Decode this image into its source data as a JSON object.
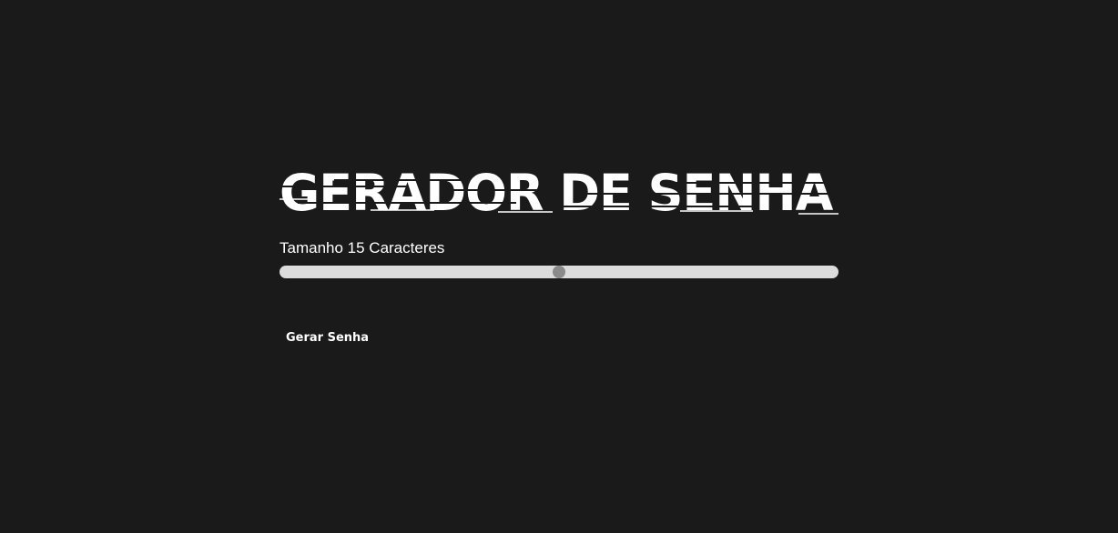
{
  "page": {
    "title": "GERADOR DE SENHA",
    "background_color": "#1a1a1a",
    "text_color": "#ffffff"
  },
  "length_control": {
    "label": "Tamanho 15 Caracteres",
    "value": 15,
    "fill_fraction": 0.5,
    "track_color": "#dcdcdc",
    "thumb_color": "#8a8a8a"
  },
  "actions": {
    "generate_label": "Gerar Senha"
  }
}
